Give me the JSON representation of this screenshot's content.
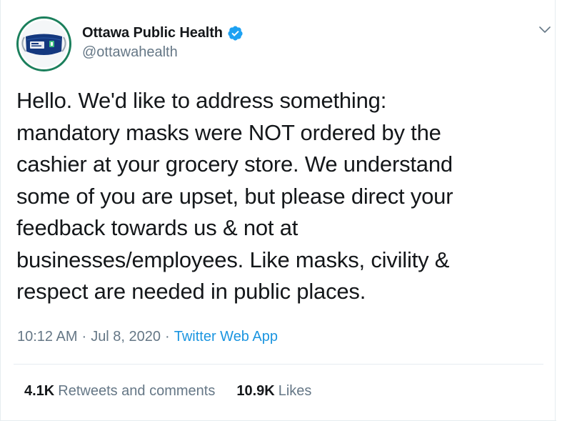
{
  "author": {
    "display_name": "Ottawa Public Health",
    "handle": "@ottawahealth",
    "verified": true
  },
  "tweet": {
    "text": "Hello. We'd like to address something:\nmandatory masks were NOT ordered by the\ncashier at your grocery store. We understand\nsome of you are upset, but please direct your\nfeedback towards us & not at\nbusinesses/employees. Like masks, civility &\nrespect are needed in public places.",
    "time": "10:12 AM",
    "date": "Jul 8, 2020",
    "separator": "·",
    "source": "Twitter Web App"
  },
  "stats": {
    "retweets_count": "4.1K",
    "retweets_label": "Retweets and comments",
    "likes_count": "10.9K",
    "likes_label": "Likes"
  },
  "icons": {
    "verified": "verified-badge-icon",
    "menu": "chevron-down-icon",
    "avatar": "mask-avatar"
  },
  "colors": {
    "text_primary": "#14171a",
    "text_secondary": "#657786",
    "link": "#1b95e0",
    "verified": "#1da1f2",
    "avatar_ring": "#1b7f5c",
    "avatar_mask": "#14387f"
  }
}
